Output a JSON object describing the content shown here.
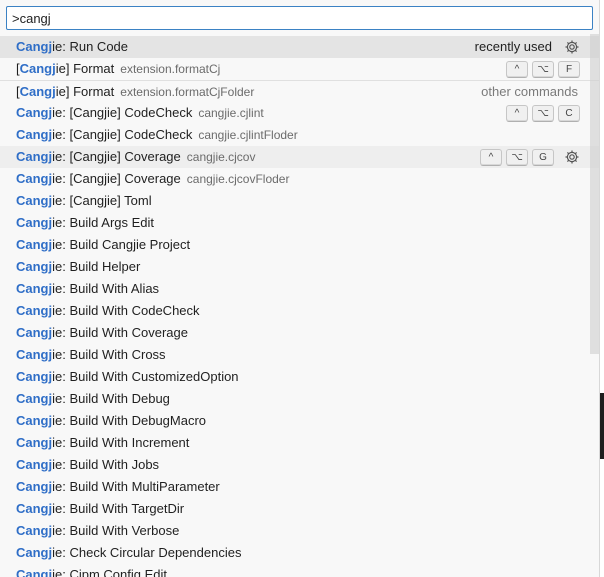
{
  "search": {
    "value": ">cangj"
  },
  "highlight": "Cangj",
  "commands": [
    {
      "pre": "",
      "rest": "ie: Run Code",
      "desc": "",
      "tag": "recently used",
      "tag_muted": false,
      "keys": [],
      "gear": true,
      "state": "selected"
    },
    {
      "pre": "[",
      "rest": "ie] Format",
      "desc": "extension.formatCj",
      "tag": "",
      "keys": [
        "^",
        "⌥",
        "F"
      ],
      "gear": false,
      "state": ""
    },
    {
      "pre": "[",
      "rest": "ie] Format",
      "desc": "extension.formatCjFolder",
      "tag": "other commands",
      "tag_muted": true,
      "keys": [],
      "gear": false,
      "state": "sep"
    },
    {
      "pre": "",
      "rest": "ie: [Cangjie] CodeCheck",
      "desc": "cangjie.cjlint",
      "tag": "",
      "keys": [
        "^",
        "⌥",
        "C"
      ],
      "gear": false,
      "state": ""
    },
    {
      "pre": "",
      "rest": "ie: [Cangjie] CodeCheck",
      "desc": "cangjie.cjlintFloder",
      "tag": "",
      "keys": [],
      "gear": false,
      "state": ""
    },
    {
      "pre": "",
      "rest": "ie: [Cangjie] Coverage",
      "desc": "cangjie.cjcov",
      "tag": "",
      "keys": [
        "^",
        "⌥",
        "G"
      ],
      "gear": true,
      "state": "hover"
    },
    {
      "pre": "",
      "rest": "ie: [Cangjie] Coverage",
      "desc": "cangjie.cjcovFloder",
      "tag": "",
      "keys": [],
      "gear": false,
      "state": ""
    },
    {
      "pre": "",
      "rest": "ie: [Cangjie] Toml",
      "desc": "",
      "tag": "",
      "keys": [],
      "gear": false,
      "state": ""
    },
    {
      "pre": "",
      "rest": "ie: Build Args Edit",
      "desc": "",
      "tag": "",
      "keys": [],
      "gear": false,
      "state": ""
    },
    {
      "pre": "",
      "rest": "ie: Build Cangjie Project",
      "desc": "",
      "tag": "",
      "keys": [],
      "gear": false,
      "state": ""
    },
    {
      "pre": "",
      "rest": "ie: Build Helper",
      "desc": "",
      "tag": "",
      "keys": [],
      "gear": false,
      "state": ""
    },
    {
      "pre": "",
      "rest": "ie: Build With Alias",
      "desc": "",
      "tag": "",
      "keys": [],
      "gear": false,
      "state": ""
    },
    {
      "pre": "",
      "rest": "ie: Build With CodeCheck",
      "desc": "",
      "tag": "",
      "keys": [],
      "gear": false,
      "state": ""
    },
    {
      "pre": "",
      "rest": "ie: Build With Coverage",
      "desc": "",
      "tag": "",
      "keys": [],
      "gear": false,
      "state": ""
    },
    {
      "pre": "",
      "rest": "ie: Build With Cross",
      "desc": "",
      "tag": "",
      "keys": [],
      "gear": false,
      "state": ""
    },
    {
      "pre": "",
      "rest": "ie: Build With CustomizedOption",
      "desc": "",
      "tag": "",
      "keys": [],
      "gear": false,
      "state": ""
    },
    {
      "pre": "",
      "rest": "ie: Build With Debug",
      "desc": "",
      "tag": "",
      "keys": [],
      "gear": false,
      "state": ""
    },
    {
      "pre": "",
      "rest": "ie: Build With DebugMacro",
      "desc": "",
      "tag": "",
      "keys": [],
      "gear": false,
      "state": ""
    },
    {
      "pre": "",
      "rest": "ie: Build With Increment",
      "desc": "",
      "tag": "",
      "keys": [],
      "gear": false,
      "state": ""
    },
    {
      "pre": "",
      "rest": "ie: Build With Jobs",
      "desc": "",
      "tag": "",
      "keys": [],
      "gear": false,
      "state": ""
    },
    {
      "pre": "",
      "rest": "ie: Build With MultiParameter",
      "desc": "",
      "tag": "",
      "keys": [],
      "gear": false,
      "state": ""
    },
    {
      "pre": "",
      "rest": "ie: Build With TargetDir",
      "desc": "",
      "tag": "",
      "keys": [],
      "gear": false,
      "state": ""
    },
    {
      "pre": "",
      "rest": "ie: Build With Verbose",
      "desc": "",
      "tag": "",
      "keys": [],
      "gear": false,
      "state": ""
    },
    {
      "pre": "",
      "rest": "ie: Check Circular Dependencies",
      "desc": "",
      "tag": "",
      "keys": [],
      "gear": false,
      "state": ""
    },
    {
      "pre": "",
      "rest": "ie: Cjpm Config Edit",
      "desc": "",
      "tag": "",
      "keys": [],
      "gear": false,
      "state": ""
    }
  ]
}
